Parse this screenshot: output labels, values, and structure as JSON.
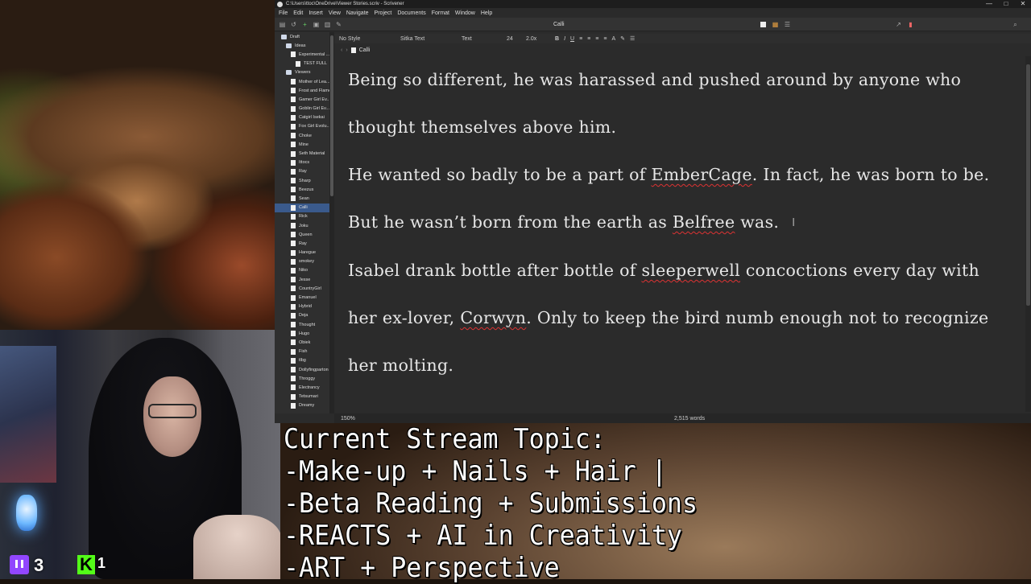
{
  "window": {
    "title": "C:\\Users\\ttoc\\OneDrive\\Viewer Stories.scriv - Scrivener",
    "controls": [
      "—",
      "□",
      "✕"
    ]
  },
  "menu": [
    "File",
    "Edit",
    "Insert",
    "View",
    "Navigate",
    "Project",
    "Documents",
    "Format",
    "Window",
    "Help"
  ],
  "toolbar": {
    "document_title": "Calli"
  },
  "binder": {
    "items": [
      {
        "label": "Draft",
        "kind": "folder",
        "indent": 0
      },
      {
        "label": "Ideas",
        "kind": "folder",
        "indent": 1
      },
      {
        "label": "Experimental ...",
        "kind": "doc",
        "indent": 2
      },
      {
        "label": "TEST FULL",
        "kind": "doc",
        "indent": 3
      },
      {
        "label": "Viewers",
        "kind": "folder",
        "indent": 1
      },
      {
        "label": "Mother of Lea...",
        "kind": "doc",
        "indent": 2
      },
      {
        "label": "Frost and Flame",
        "kind": "doc",
        "indent": 2
      },
      {
        "label": "Gamer Girl Ev...",
        "kind": "doc",
        "indent": 2
      },
      {
        "label": "Goblin Girl Ev...",
        "kind": "doc",
        "indent": 2
      },
      {
        "label": "Catgirl Isekai",
        "kind": "doc",
        "indent": 2
      },
      {
        "label": "Fox Girl Evolu...",
        "kind": "doc",
        "indent": 2
      },
      {
        "label": "Choke",
        "kind": "doc",
        "indent": 2
      },
      {
        "label": "Mine",
        "kind": "doc",
        "indent": 2
      },
      {
        "label": "Seth Material",
        "kind": "doc",
        "indent": 2
      },
      {
        "label": "Ittocs",
        "kind": "doc",
        "indent": 2
      },
      {
        "label": "Ray",
        "kind": "doc",
        "indent": 2
      },
      {
        "label": "Sharp",
        "kind": "doc",
        "indent": 2
      },
      {
        "label": "Beezus",
        "kind": "doc",
        "indent": 2
      },
      {
        "label": "Sean",
        "kind": "doc",
        "indent": 2
      },
      {
        "label": "Calli",
        "kind": "doc",
        "indent": 2,
        "selected": true
      },
      {
        "label": "Rick",
        "kind": "doc",
        "indent": 2
      },
      {
        "label": "Joku",
        "kind": "doc",
        "indent": 2
      },
      {
        "label": "Queen",
        "kind": "doc",
        "indent": 2
      },
      {
        "label": "Ray",
        "kind": "doc",
        "indent": 2
      },
      {
        "label": "Haregue",
        "kind": "doc",
        "indent": 2
      },
      {
        "label": "smokey",
        "kind": "doc",
        "indent": 2
      },
      {
        "label": "Niko",
        "kind": "doc",
        "indent": 2
      },
      {
        "label": "Jesse",
        "kind": "doc",
        "indent": 2
      },
      {
        "label": "CountryGirl",
        "kind": "doc",
        "indent": 2
      },
      {
        "label": "Emanuel",
        "kind": "doc",
        "indent": 2
      },
      {
        "label": "Hybrid",
        "kind": "doc",
        "indent": 2
      },
      {
        "label": "Deja",
        "kind": "doc",
        "indent": 2
      },
      {
        "label": "Thought",
        "kind": "doc",
        "indent": 2
      },
      {
        "label": "Hugo",
        "kind": "doc",
        "indent": 2
      },
      {
        "label": "Obiek",
        "kind": "doc",
        "indent": 2
      },
      {
        "label": "Fish",
        "kind": "doc",
        "indent": 2
      },
      {
        "label": "tlbg",
        "kind": "doc",
        "indent": 2
      },
      {
        "label": "Dollyfingparton",
        "kind": "doc",
        "indent": 2
      },
      {
        "label": "Throggy",
        "kind": "doc",
        "indent": 2
      },
      {
        "label": "Electrancy",
        "kind": "doc",
        "indent": 2
      },
      {
        "label": "Tetsumari",
        "kind": "doc",
        "indent": 2
      },
      {
        "label": "Dreamy",
        "kind": "doc",
        "indent": 2
      }
    ]
  },
  "format_bar": {
    "style": "No Style",
    "font": "Sitka Text",
    "face": "Text",
    "size": "24",
    "spacing": "2.0x",
    "buttons": [
      "B",
      "I",
      "U"
    ]
  },
  "header": {
    "doc": "Calli",
    "nav_back": "‹",
    "nav_fwd": "›"
  },
  "editor": {
    "lines": [
      [
        {
          "t": "Being so different, he was harassed and pushed around by anyone who"
        }
      ],
      [
        {
          "t": "thought themselves above him."
        }
      ],
      [
        {
          "t": "He wanted so badly to be a part of "
        },
        {
          "t": "EmberCage",
          "spell": true
        },
        {
          "t": ". In fact, he was born to be."
        }
      ],
      [
        {
          "t": "But he wasn’t born from the earth as "
        },
        {
          "t": "Belfree",
          "spell": true
        },
        {
          "t": " was."
        }
      ],
      [
        {
          "t": "Isabel drank bottle after bottle of "
        },
        {
          "t": "sleeperwell",
          "spell": true
        },
        {
          "t": " concoctions every day with"
        }
      ],
      [
        {
          "t": "her ex-lover, "
        },
        {
          "t": "Corwyn",
          "spell": true
        },
        {
          "t": ". Only to keep the bird numb enough not to recognize"
        }
      ],
      [
        {
          "t": "her molting."
        }
      ]
    ]
  },
  "footer": {
    "zoom": "150%",
    "word_count": "2,515 words"
  },
  "stream_topic": {
    "lines": [
      "Current Stream Topic:",
      "-Make-up + Nails + Hair |",
      "-Beta Reading + Submissions",
      "-REACTS + AI in Creativity",
      "-ART + Perspective"
    ]
  },
  "stats": {
    "twitch_count": "3",
    "kick_count": "1"
  }
}
